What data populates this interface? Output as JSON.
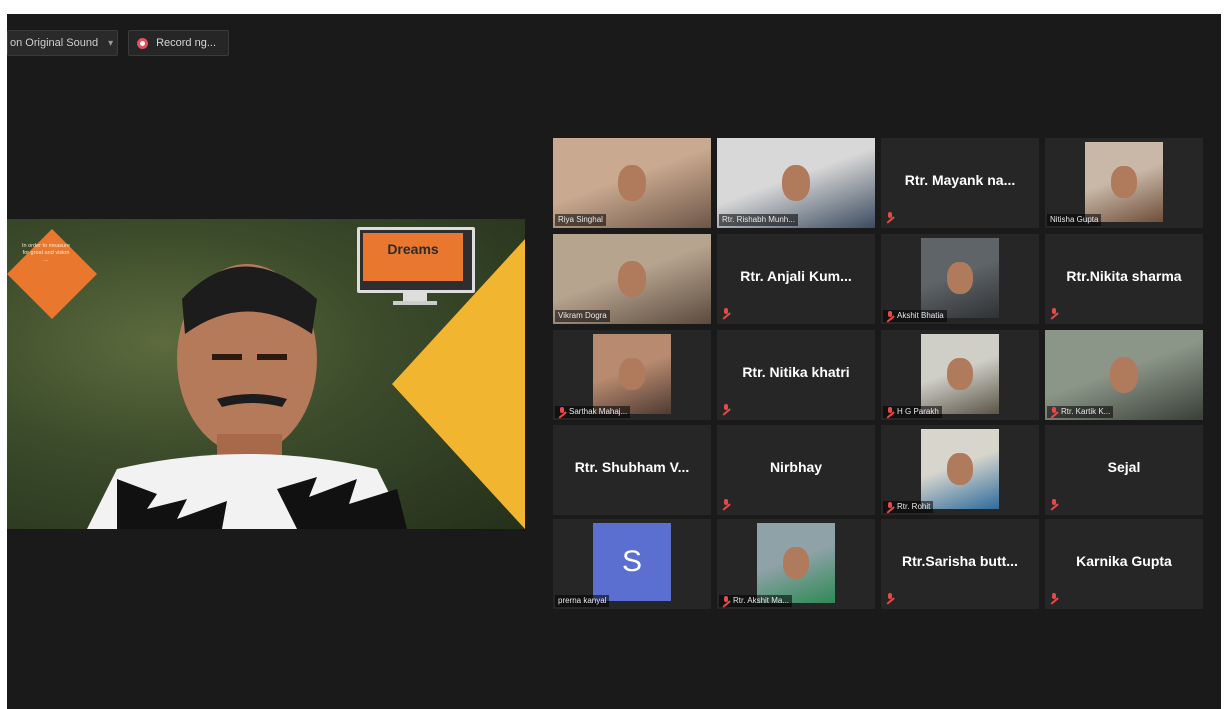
{
  "toolbar": {
    "sound_label": "on Original Sound",
    "recording_label": "Record ng..."
  },
  "share": {
    "bubble_text": "In order to measure for great and vision ...",
    "panel_title": "Dreams"
  },
  "participants": [
    {
      "name": "Riya Singhal",
      "type": "video",
      "muted": false
    },
    {
      "name": "Rtr. Rishabh Munh...",
      "type": "video",
      "muted": false
    },
    {
      "name": "Rtr. Mayank na...",
      "type": "name",
      "muted": true
    },
    {
      "name": "Nitisha Gupta",
      "type": "video",
      "muted": false
    },
    {
      "name": "Vikram Dogra",
      "type": "video",
      "muted": false,
      "active": true
    },
    {
      "name": "Rtr. Anjali Kum...",
      "type": "name",
      "muted": true
    },
    {
      "name": "Akshit Bhatia",
      "type": "video",
      "muted": true
    },
    {
      "name": "Rtr.Nikita sharma",
      "type": "name",
      "muted": true
    },
    {
      "name": "Sarthak Mahaj...",
      "type": "video",
      "muted": true
    },
    {
      "name": "Rtr. Nitika khatri",
      "type": "name",
      "muted": true
    },
    {
      "name": "H G Parakh",
      "type": "video",
      "muted": true
    },
    {
      "name": "Rtr. Kartik K...",
      "type": "video",
      "muted": true
    },
    {
      "name": "Rtr. Shubham V...",
      "type": "name",
      "muted": false
    },
    {
      "name": "Nirbhay",
      "type": "name",
      "muted": true
    },
    {
      "name": "Rtr. Rohit",
      "type": "video",
      "muted": true
    },
    {
      "name": "Sejal",
      "type": "name",
      "muted": true
    },
    {
      "name": "prerna kanyal",
      "type": "avatar",
      "initial": "S",
      "muted": false
    },
    {
      "name": "Rtr. Akshit Ma...",
      "type": "video",
      "muted": true
    },
    {
      "name": "Rtr.Sarisha butt...",
      "type": "name",
      "muted": true
    },
    {
      "name": "Karnika Gupta",
      "type": "name",
      "muted": true
    }
  ],
  "colors": {
    "app_bg": "#1a1a1a",
    "tile_bg": "#262626",
    "active_speaker": "#b6d24a",
    "muted_icon": "#e84848",
    "avatar_bg": "#5a6fd0",
    "accent_orange": "#e9772d",
    "accent_yellow": "#f2b530"
  }
}
